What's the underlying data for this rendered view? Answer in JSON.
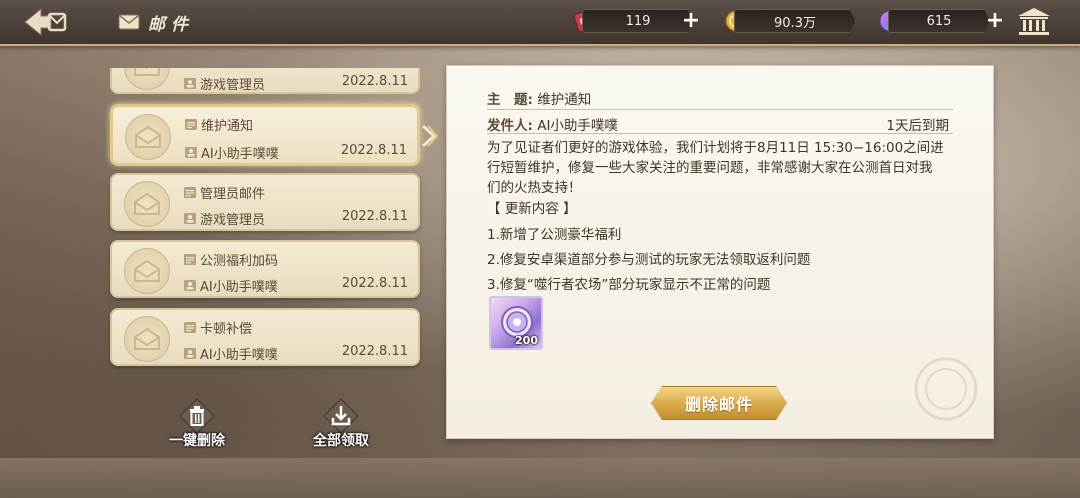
{
  "header": {
    "title": "邮件",
    "resources": [
      {
        "name": "ticket",
        "value": "119",
        "icon": "red-ticket-icon"
      },
      {
        "name": "gold",
        "value": "90.3万",
        "icon": "gold-coin-icon"
      },
      {
        "name": "gem",
        "value": "615",
        "icon": "rainbow-gem-icon"
      }
    ]
  },
  "mails": [
    {
      "subject": "",
      "sender": "游戏管理员",
      "date": "2022.8.11",
      "selected": false
    },
    {
      "subject": "维护通知",
      "sender": "AI小助手噗噗",
      "date": "2022.8.11",
      "selected": true
    },
    {
      "subject": "管理员邮件",
      "sender": "游戏管理员",
      "date": "2022.8.11",
      "selected": false
    },
    {
      "subject": "公测福利加码",
      "sender": "AI小助手噗噗",
      "date": "2022.8.11",
      "selected": false
    },
    {
      "subject": "卡顿补偿",
      "sender": "AI小助手噗噗",
      "date": "2022.8.11",
      "selected": false
    }
  ],
  "actions": {
    "delete_all": "一键删除",
    "claim_all": "全部领取"
  },
  "detail": {
    "subject_label": "主　题:",
    "subject": "维护通知",
    "sender_label": "发件人:",
    "sender": "AI小助手噗噗",
    "expire": "1天后到期",
    "body_lines": [
      "为了见证者们更好的游戏体验，我们计划将于8月11日 15:30−16:00之间进",
      "行短暂维护，修复一些大家关注的重要问题，非常感谢大家在公测首日对我",
      "们的火热支持！"
    ],
    "update_header": "【 更新内容 】",
    "updates": [
      "1.新增了公测豪华福利",
      "2.修复安卓渠道部分参与测试的玩家无法领取返利问题",
      "3.修复“噬行者农场”部分玩家显示不正常的问题"
    ],
    "reward_qty": "200",
    "delete_button": "删除邮件"
  },
  "colors": {
    "accent_gold": "#d8a94a",
    "panel_bg": "#fbf8f1",
    "text_brown": "#5a4a38"
  }
}
